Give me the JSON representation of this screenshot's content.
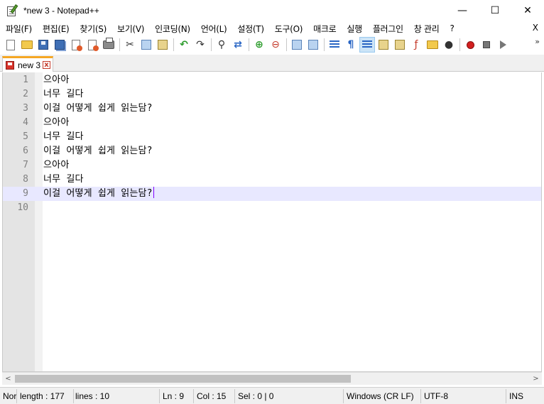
{
  "window": {
    "title": "*new 3 - Notepad++",
    "controls": {
      "minimize": "—",
      "maximize": "☐",
      "close": "✕"
    }
  },
  "menu": {
    "items": [
      "파일(F)",
      "편집(E)",
      "찾기(S)",
      "보기(V)",
      "인코딩(N)",
      "언어(L)",
      "설정(T)",
      "도구(O)",
      "매크로",
      "실행",
      "플러그인",
      "창 관리",
      "?"
    ],
    "close_label": "X"
  },
  "toolbar": {
    "buttons": [
      "new-file",
      "open-file",
      "save",
      "save-all",
      "close",
      "close-all",
      "print",
      "cut",
      "copy",
      "paste",
      "undo",
      "redo",
      "find",
      "replace",
      "zoom-in",
      "zoom-out",
      "sync-vertical",
      "sync-horizontal",
      "word-wrap",
      "show-all-chars",
      "indent-guide",
      "user-defined-language",
      "document-map",
      "function-list",
      "folder-as-workspace",
      "document-list",
      "monitoring",
      "record-macro",
      "stop-recording",
      "playback-macro"
    ],
    "more": "»"
  },
  "tabs": [
    {
      "label": "new 3",
      "close": "x",
      "unsaved": true
    }
  ],
  "editor": {
    "lines": [
      {
        "no": "1",
        "text": "으아아"
      },
      {
        "no": "2",
        "text": "너무 길다"
      },
      {
        "no": "3",
        "text": "이걸 어떻게 쉽게 읽는담?"
      },
      {
        "no": "4",
        "text": "으아아"
      },
      {
        "no": "5",
        "text": "너무 길다"
      },
      {
        "no": "6",
        "text": "이걸 어떻게 쉽게 읽는담?"
      },
      {
        "no": "7",
        "text": "으아아"
      },
      {
        "no": "8",
        "text": "너무 길다"
      },
      {
        "no": "9",
        "text": "이걸 어떻게 쉽게 읽는담?"
      },
      {
        "no": "10",
        "text": ""
      }
    ],
    "current_line": 9,
    "current_line_color": "#e8e8ff",
    "caret_color": "#8000ff"
  },
  "hscroll": {
    "left": "<",
    "right": ">"
  },
  "status": {
    "doc_type": "Nor",
    "length": "length : 177",
    "lines": "lines : 10",
    "ln": "Ln : 9",
    "col": "Col : 15",
    "sel": "Sel : 0 | 0",
    "eol": "Windows (CR LF)",
    "encoding": "UTF-8",
    "mode": "INS"
  }
}
